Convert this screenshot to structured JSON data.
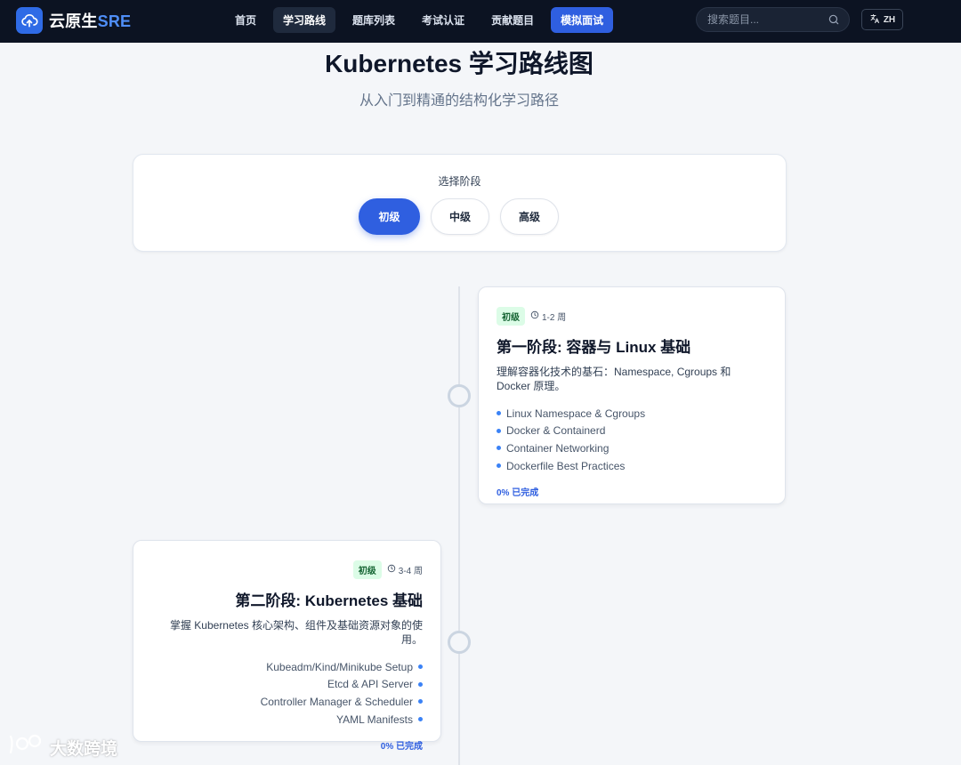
{
  "brand": {
    "name_prefix": "云原生",
    "name_accent": "SRE"
  },
  "nav": {
    "items": [
      {
        "label": "首页"
      },
      {
        "label": "学习路线"
      },
      {
        "label": "题库列表"
      },
      {
        "label": "考试认证"
      },
      {
        "label": "贡献题目"
      },
      {
        "label": "模拟面试"
      }
    ],
    "active_index": 1
  },
  "search": {
    "placeholder": "搜索题目...",
    "icon": "search-icon"
  },
  "language": {
    "label": "ZH",
    "icon": "translate-icon"
  },
  "header": {
    "title": "Kubernetes 学习路线图",
    "subtitle": "从入门到精通的结构化学习路径"
  },
  "stage_selector": {
    "label": "选择阶段",
    "options": [
      "初级",
      "中级",
      "高级"
    ],
    "selected": "初级"
  },
  "phases": [
    {
      "badge": "初级",
      "duration": "1-2 周",
      "title": "第一阶段: 容器与 Linux 基础",
      "description": "理解容器化技术的基石：Namespace, Cgroups 和 Docker 原理。",
      "topics": [
        "Linux Namespace & Cgroups",
        "Docker & Containerd",
        "Container Networking",
        "Dockerfile Best Practices"
      ],
      "progress": "0% 已完成"
    },
    {
      "badge": "初级",
      "duration": "3-4 周",
      "title": "第二阶段: Kubernetes 基础",
      "description": "掌握 Kubernetes 核心架构、组件及基础资源对象的使用。",
      "topics": [
        "Kubeadm/Kind/Minikube Setup",
        "Etcd & API Server",
        "Controller Manager & Scheduler",
        "YAML Manifests"
      ],
      "progress": "0% 已完成"
    }
  ],
  "watermark": {
    "text": "大数跨境"
  },
  "colors": {
    "navbar": "#0c1322",
    "primary": "#2f5fe0",
    "badge_bg": "#dcfce7",
    "badge_text": "#166534",
    "bullet": "#3b82f6"
  }
}
